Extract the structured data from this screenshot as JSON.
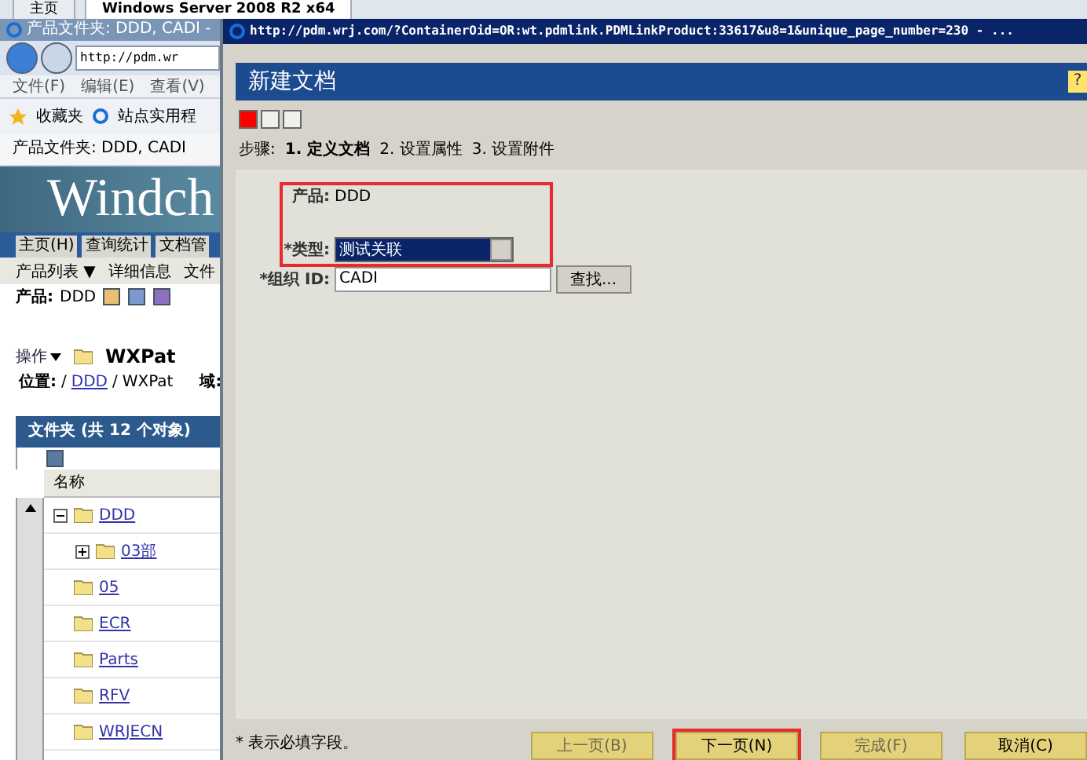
{
  "browser_tabs": [
    {
      "label": "主页",
      "selected": false
    },
    {
      "label": "Windows Server 2008 R2 x64",
      "selected": true
    }
  ],
  "back_window": {
    "title": "产品文件夹: DDD, CADI -",
    "address": "http://pdm.wr",
    "menu": [
      "文件(F)",
      "编辑(E)",
      "查看(V)"
    ],
    "favorites": [
      "收藏夹",
      "站点实用程"
    ],
    "page_tab": "产品文件夹: DDD, CADI",
    "banner": "Windch",
    "nav_tabs": [
      {
        "label": "主页(H)",
        "selected": false
      },
      {
        "label": "查询统计",
        "selected": false
      },
      {
        "label": "文档管",
        "selected": false
      }
    ],
    "sub_nav": [
      "产品列表 ▼",
      "详细信息",
      "文件"
    ],
    "product_label": "产品:",
    "product_value": "DDD",
    "actions": "操作",
    "folder_title": "WXPat",
    "location": {
      "label": "位置:",
      "path": [
        {
          "separator": "/",
          "name": "DDD"
        },
        {
          "separator": "/",
          "name": "WXPat"
        }
      ],
      "domain": "域:"
    },
    "table": {
      "title": "文件夹 (共 12 个对象)",
      "column": "名称",
      "rows": [
        {
          "name": "DDD",
          "expanded": true,
          "children": [
            {
              "name": "03部",
              "expanded": false
            }
          ]
        },
        {
          "name": "05"
        },
        {
          "name": "ECR"
        },
        {
          "name": "Parts"
        },
        {
          "name": "RFV"
        },
        {
          "name": "WRJECN"
        }
      ]
    }
  },
  "dialog": {
    "title": "http://pdm.wrj.com/?ContainerOid=OR:wt.pdmlink.PDMLinkProduct:33617&u8=1&unique_page_number=230 - ...",
    "heading": "新建文档",
    "help": "?",
    "steps_label": "步骤:",
    "steps": [
      {
        "label": "1. 定义文档",
        "selected": true
      },
      {
        "label": "2. 设置属性",
        "selected": false
      },
      {
        "label": "3. 设置附件",
        "selected": false
      }
    ],
    "product": {
      "label": "产品:",
      "value": "DDD"
    },
    "type": {
      "label": "*类型:",
      "value": "测试关联"
    },
    "org": {
      "label": "*组织 ID:",
      "value": "CADI",
      "button": "查找..."
    },
    "note": "* 表示必填字段。",
    "buttons": [
      {
        "label": "上一页(B)",
        "disabled": true,
        "highlighted": false
      },
      {
        "label": "下一页(N)",
        "disabled": false,
        "highlighted": true
      },
      {
        "label": "完成(F)",
        "disabled": true,
        "highlighted": false
      },
      {
        "label": "取消(C)",
        "disabled": false,
        "highlighted": false
      }
    ]
  }
}
